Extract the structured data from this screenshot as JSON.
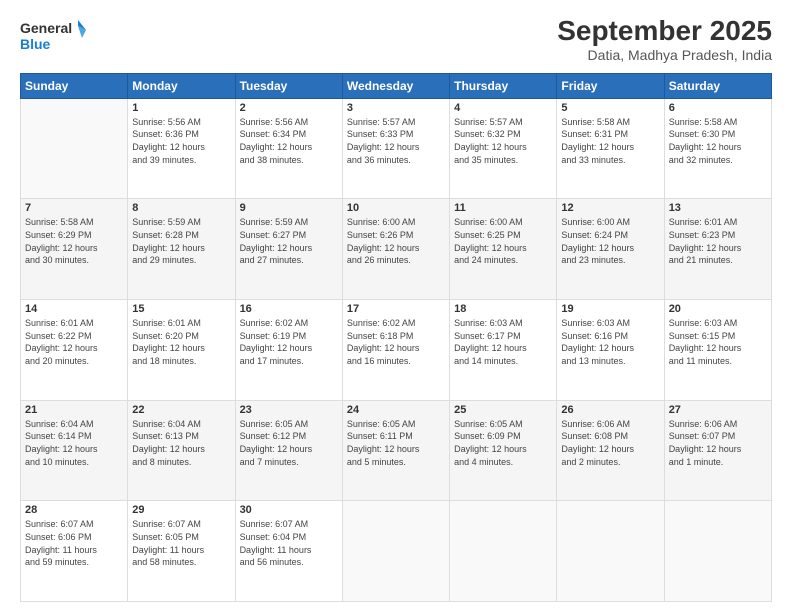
{
  "header": {
    "logo_line1": "General",
    "logo_line2": "Blue",
    "title": "September 2025",
    "subtitle": "Datia, Madhya Pradesh, India"
  },
  "weekdays": [
    "Sunday",
    "Monday",
    "Tuesday",
    "Wednesday",
    "Thursday",
    "Friday",
    "Saturday"
  ],
  "weeks": [
    [
      {
        "day": "",
        "info": ""
      },
      {
        "day": "1",
        "info": "Sunrise: 5:56 AM\nSunset: 6:36 PM\nDaylight: 12 hours\nand 39 minutes."
      },
      {
        "day": "2",
        "info": "Sunrise: 5:56 AM\nSunset: 6:34 PM\nDaylight: 12 hours\nand 38 minutes."
      },
      {
        "day": "3",
        "info": "Sunrise: 5:57 AM\nSunset: 6:33 PM\nDaylight: 12 hours\nand 36 minutes."
      },
      {
        "day": "4",
        "info": "Sunrise: 5:57 AM\nSunset: 6:32 PM\nDaylight: 12 hours\nand 35 minutes."
      },
      {
        "day": "5",
        "info": "Sunrise: 5:58 AM\nSunset: 6:31 PM\nDaylight: 12 hours\nand 33 minutes."
      },
      {
        "day": "6",
        "info": "Sunrise: 5:58 AM\nSunset: 6:30 PM\nDaylight: 12 hours\nand 32 minutes."
      }
    ],
    [
      {
        "day": "7",
        "info": "Sunrise: 5:58 AM\nSunset: 6:29 PM\nDaylight: 12 hours\nand 30 minutes."
      },
      {
        "day": "8",
        "info": "Sunrise: 5:59 AM\nSunset: 6:28 PM\nDaylight: 12 hours\nand 29 minutes."
      },
      {
        "day": "9",
        "info": "Sunrise: 5:59 AM\nSunset: 6:27 PM\nDaylight: 12 hours\nand 27 minutes."
      },
      {
        "day": "10",
        "info": "Sunrise: 6:00 AM\nSunset: 6:26 PM\nDaylight: 12 hours\nand 26 minutes."
      },
      {
        "day": "11",
        "info": "Sunrise: 6:00 AM\nSunset: 6:25 PM\nDaylight: 12 hours\nand 24 minutes."
      },
      {
        "day": "12",
        "info": "Sunrise: 6:00 AM\nSunset: 6:24 PM\nDaylight: 12 hours\nand 23 minutes."
      },
      {
        "day": "13",
        "info": "Sunrise: 6:01 AM\nSunset: 6:23 PM\nDaylight: 12 hours\nand 21 minutes."
      }
    ],
    [
      {
        "day": "14",
        "info": "Sunrise: 6:01 AM\nSunset: 6:22 PM\nDaylight: 12 hours\nand 20 minutes."
      },
      {
        "day": "15",
        "info": "Sunrise: 6:01 AM\nSunset: 6:20 PM\nDaylight: 12 hours\nand 18 minutes."
      },
      {
        "day": "16",
        "info": "Sunrise: 6:02 AM\nSunset: 6:19 PM\nDaylight: 12 hours\nand 17 minutes."
      },
      {
        "day": "17",
        "info": "Sunrise: 6:02 AM\nSunset: 6:18 PM\nDaylight: 12 hours\nand 16 minutes."
      },
      {
        "day": "18",
        "info": "Sunrise: 6:03 AM\nSunset: 6:17 PM\nDaylight: 12 hours\nand 14 minutes."
      },
      {
        "day": "19",
        "info": "Sunrise: 6:03 AM\nSunset: 6:16 PM\nDaylight: 12 hours\nand 13 minutes."
      },
      {
        "day": "20",
        "info": "Sunrise: 6:03 AM\nSunset: 6:15 PM\nDaylight: 12 hours\nand 11 minutes."
      }
    ],
    [
      {
        "day": "21",
        "info": "Sunrise: 6:04 AM\nSunset: 6:14 PM\nDaylight: 12 hours\nand 10 minutes."
      },
      {
        "day": "22",
        "info": "Sunrise: 6:04 AM\nSunset: 6:13 PM\nDaylight: 12 hours\nand 8 minutes."
      },
      {
        "day": "23",
        "info": "Sunrise: 6:05 AM\nSunset: 6:12 PM\nDaylight: 12 hours\nand 7 minutes."
      },
      {
        "day": "24",
        "info": "Sunrise: 6:05 AM\nSunset: 6:11 PM\nDaylight: 12 hours\nand 5 minutes."
      },
      {
        "day": "25",
        "info": "Sunrise: 6:05 AM\nSunset: 6:09 PM\nDaylight: 12 hours\nand 4 minutes."
      },
      {
        "day": "26",
        "info": "Sunrise: 6:06 AM\nSunset: 6:08 PM\nDaylight: 12 hours\nand 2 minutes."
      },
      {
        "day": "27",
        "info": "Sunrise: 6:06 AM\nSunset: 6:07 PM\nDaylight: 12 hours\nand 1 minute."
      }
    ],
    [
      {
        "day": "28",
        "info": "Sunrise: 6:07 AM\nSunset: 6:06 PM\nDaylight: 11 hours\nand 59 minutes."
      },
      {
        "day": "29",
        "info": "Sunrise: 6:07 AM\nSunset: 6:05 PM\nDaylight: 11 hours\nand 58 minutes."
      },
      {
        "day": "30",
        "info": "Sunrise: 6:07 AM\nSunset: 6:04 PM\nDaylight: 11 hours\nand 56 minutes."
      },
      {
        "day": "",
        "info": ""
      },
      {
        "day": "",
        "info": ""
      },
      {
        "day": "",
        "info": ""
      },
      {
        "day": "",
        "info": ""
      }
    ]
  ]
}
